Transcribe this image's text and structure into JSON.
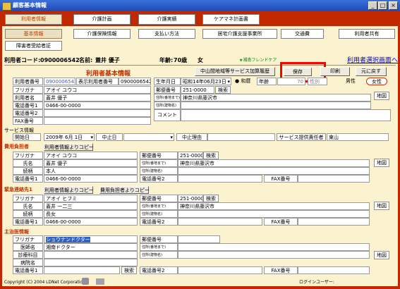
{
  "window": {
    "title": "顧客基本情報",
    "minimize": "_",
    "maximize": "□",
    "close": "×"
  },
  "main_tabs": [
    "利用者情報",
    "介護計画",
    "介護実績",
    "ケアマネ計画書"
  ],
  "sub_tabs": [
    "基本情報",
    "介護保険情報",
    "支払い方法",
    "居宅介護支援事業所",
    "交通費",
    "利用者共有",
    "障害者受給者証"
  ],
  "header": {
    "code_label": "利用者コード:",
    "code_value": "0900006542",
    "name_label": "名前:",
    "name_value": "蓋井 優子",
    "age_label": "年齢:",
    "age_value": "70歳",
    "sex_value": "女",
    "facility": "★湘南フレンドケア",
    "select_link": "利用者選択画面へ"
  },
  "toolbar": {
    "service_history": "中山間地域等サービス加算履歴",
    "save": "保存",
    "print": "印刷",
    "back": "元に戻す"
  },
  "basic": {
    "title": "利用者基本情報",
    "id_label": "利用者番号",
    "id_value": "0900006542",
    "display_id_label": "表示利用者番号",
    "display_id_value": "0900006542",
    "birth_label": "生年月日",
    "birth_value": "昭和14年06月23日",
    "era": "和暦",
    "age_label": "年齢",
    "age_value": "70",
    "sex_label": "性別",
    "male": "男性",
    "female": "女性",
    "furigana_label": "フリガナ",
    "furigana_value": "アオイ ユウコ",
    "name_label": "利用者名",
    "name_value": "蓋井 優子",
    "phone1_label": "電話番号1",
    "phone1_value": "0466-00-0000",
    "phone2_label": "電話番号2",
    "fax_label": "FAX番号",
    "postal_label": "郵便番号",
    "postal_value": "251-0000",
    "search": "検索",
    "addr1_label": "住所(番地まで)",
    "addr1_value": "神奈川県藤沢市",
    "addr2_label": "住所(建物名)",
    "comment_label": "コメント",
    "map": "地図"
  },
  "service": {
    "title": "サービス情報",
    "start_label": "開始日",
    "start_value": "2009年 6月 1日",
    "stop_label": "中止日",
    "reason_label": "中止理由",
    "provider_label": "サービス提供責任者",
    "provider_value": "東山"
  },
  "payer": {
    "title": "費用負担者",
    "copy": "利用者情報よりコピー",
    "furigana_label": "フリガナ",
    "furigana_value": "アオイ ユウコ",
    "name_label": "氏名",
    "name_value": "蓋井 優子",
    "relation_label": "続柄",
    "relation_value": "本人",
    "phone1_label": "電話番号1",
    "phone1_value": "0466-00-0000",
    "postal_label": "郵便番号",
    "postal_value": "251-0000",
    "search": "検索",
    "addr1_label": "住所(番地まで)",
    "addr1_value": "神奈川県藤沢市",
    "addr2_label": "住所(建物名)",
    "phone2_label": "電話番号2",
    "fax_label": "FAX番号",
    "map": "地図"
  },
  "emergency": {
    "title": "緊急連絡先1",
    "copy1": "利用者情報よりコピー",
    "copy2": "費用負担者よりコピー",
    "furigana_label": "フリガナ",
    "furigana_value": "アオイ ヒフミ",
    "name_label": "氏名",
    "name_value": "蓋井 一二三",
    "relation_label": "続柄",
    "relation_value": "長女",
    "phone1_label": "電話番号1",
    "phone1_value": "0466-00-0000",
    "postal_label": "郵便番号",
    "postal_value": "251-0000",
    "search": "検索",
    "addr1_label": "住所(番地まで)",
    "addr1_value": "神奈川県藤沢市",
    "addr2_label": "住所(建物名)",
    "phone2_label": "電話番号2",
    "fax_label": "FAX番号",
    "map": "地図"
  },
  "doctor": {
    "title": "主治医情報",
    "furigana_label": "フリガナ",
    "furigana_value": "ショウナンドクター",
    "name_label": "医師名",
    "name_value": "湘南ドクター",
    "dept_label": "診療科目",
    "hospital_label": "病院名",
    "phone1_label": "電話番号1",
    "search": "検索",
    "postal_label": "郵便番号",
    "addr1_label": "住所(番地まで)",
    "addr2_label": "住所(建物名)",
    "phone2_label": "電話番号2",
    "fax_label": "FAX番号",
    "map": "地図"
  },
  "footer": {
    "copyright": "Copyright (C) 2004 LDNet Corporation",
    "login": "ログインユーザー:"
  }
}
